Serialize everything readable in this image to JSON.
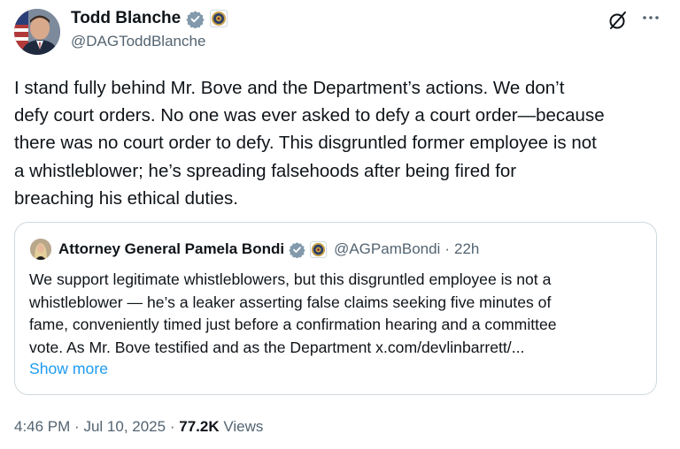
{
  "author": {
    "name": "Todd Blanche",
    "handle": "@DAGToddBlanche"
  },
  "tweet": {
    "text": "I stand fully behind Mr. Bove and the Department’s actions. We don’t\ndefy court orders. No one was ever asked to defy a court order—because\nthere was no court order to defy. This disgruntled former employee is not\na whistleblower; he’s spreading falsehoods after being fired for\nbreaching his ethical duties."
  },
  "quote": {
    "name": "Attorney General Pamela Bondi",
    "handle": "@AGPamBondi",
    "separator": "·",
    "time": "22h",
    "text": "We support legitimate whistleblowers, but this disgruntled employee is not a\nwhistleblower — he’s a leaker asserting false claims seeking five minutes of\nfame, conveniently timed just before a confirmation hearing and a committee\nvote. As Mr. Bove testified and as the Department x.com/devlinbarrett/...",
    "show_more": "Show more"
  },
  "meta": {
    "time": "4:46 PM",
    "separator": "·",
    "date": "Jul 10, 2025",
    "views_count": "77.2K",
    "views_label": "Views"
  },
  "colors": {
    "verified": "#829aab",
    "link": "#1d9bf0",
    "secondary_text": "#536471",
    "border": "#cfd9de"
  },
  "icons": {
    "verified": "verified-badge-icon",
    "affiliation": "doj-seal-icon",
    "grok": "grok-icon",
    "more": "more-icon"
  }
}
